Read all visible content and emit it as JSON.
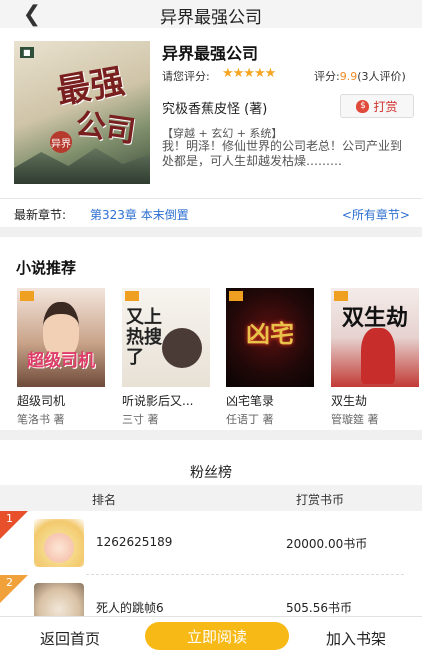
{
  "header": {
    "title": "异界最强公司",
    "back_icon": "chevron-left-icon"
  },
  "book": {
    "cover_title_1": "最强",
    "cover_title_2": "公司",
    "cover_seal": "异界",
    "title": "异界最强公司",
    "rate_label": "请您评分:",
    "stars": "★★★★★",
    "score_prefix": "评分:",
    "score_value": "9.9",
    "score_suffix": "(3人评价)",
    "author": "究极香蕉皮怪 (著)",
    "tip_label": "打赏",
    "tags": "【穿越 + 玄幻 + 系统】",
    "description": "我！明泽！修仙世界的公司老总！公司产业到处都是，可人生却越发枯燥………"
  },
  "latest": {
    "label": "最新章节:",
    "chapter": "第323章 本末倒置",
    "all_link": "<所有章节>"
  },
  "recommend": {
    "title": "小说推荐",
    "items": [
      {
        "name": "超级司机",
        "author": "笔洛书 著",
        "cover_text": "超级司机"
      },
      {
        "name": "听说影后又...",
        "author": "三寸 著",
        "cover_text": "又上热搜了"
      },
      {
        "name": "凶宅笔录",
        "author": "任语丁 著",
        "cover_text": "凶宅"
      },
      {
        "name": "双生劫",
        "author": "管璇筵 著",
        "cover_text": "双生劫"
      }
    ]
  },
  "fans": {
    "title": "粉丝榜",
    "col_rank": "排名",
    "col_coins": "打赏书币",
    "rows": [
      {
        "rank": "1",
        "name": "1262625189",
        "amount": "20000.00书币"
      },
      {
        "rank": "2",
        "name": "死人的跳帧6",
        "amount": "505.56书币"
      }
    ]
  },
  "bottom": {
    "home": "返回首页",
    "read": "立即阅读",
    "shelf": "加入书架"
  },
  "colors": {
    "accent": "#f7b916",
    "link": "#2c6fd1",
    "rank_badge": "#e8502c",
    "score": "#f08a24"
  }
}
